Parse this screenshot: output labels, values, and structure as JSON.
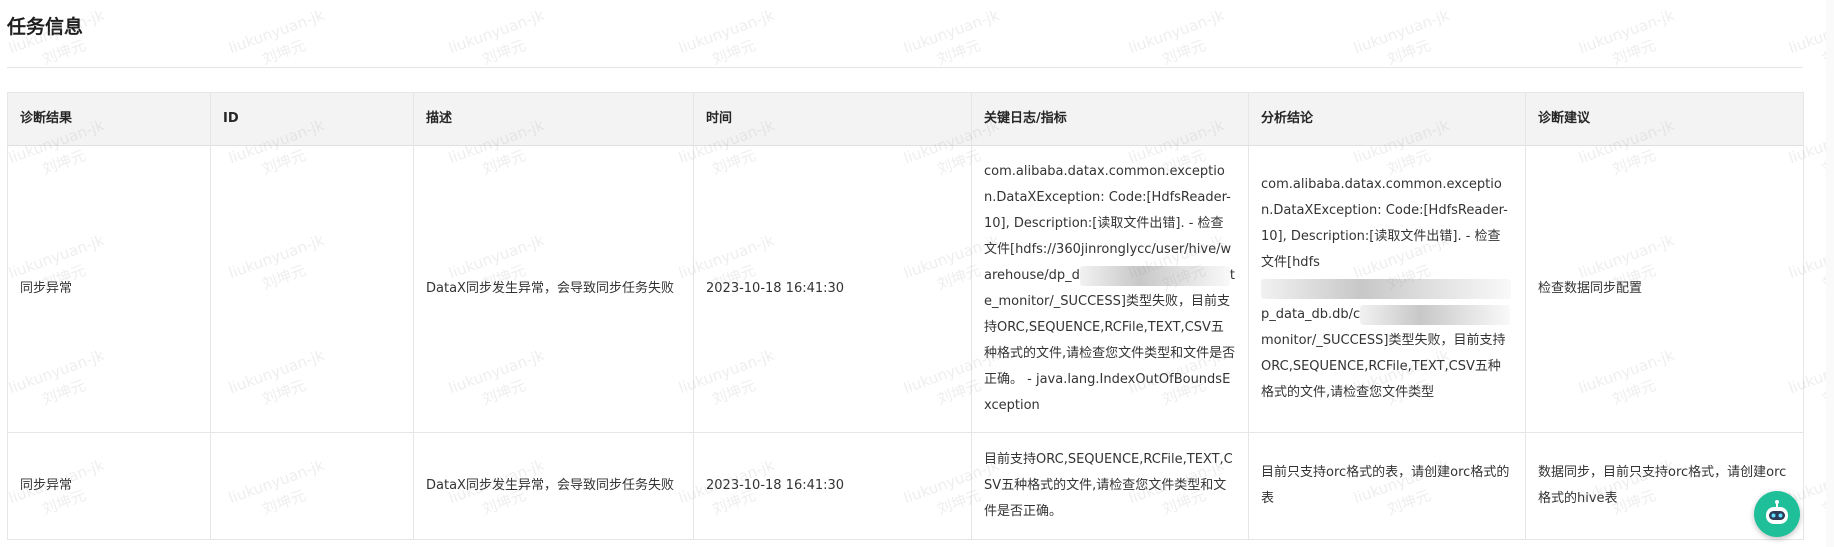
{
  "section": {
    "title": "任务信息"
  },
  "table": {
    "headers": [
      "诊断结果",
      "ID",
      "描述",
      "时间",
      "关键日志/指标",
      "分析结论",
      "诊断建议"
    ],
    "rows": [
      {
        "result": "同步异常",
        "id": "",
        "description": "DataX同步发生异常，会导致同步任务失败",
        "time": "2023-10-18 16:41:30",
        "log_before": "com.alibaba.datax.common.exception.DataXException: Code:[HdfsReader-10], Description:[读取文件出错]. - 检查文件[hdfs://360jinronglycc/user/hive/warehouse/dp_d",
        "log_after": "te_monitor/_SUCCESS]类型失败，目前支持ORC,SEQUENCE,RCFile,TEXT,CSV五种格式的文件,请检查您文件类型和文件是否正确。 - java.lang.IndexOutOfBoundsException",
        "analysis_before": "com.alibaba.datax.common.exception.DataXException: Code:[HdfsReader-10], Description:[读取文件出错]. - 检查文件[hdfs",
        "analysis_mid": "p_data_db.db/c",
        "analysis_after": "monitor/_SUCCESS]类型失败，目前支持ORC,SEQUENCE,RCFile,TEXT,CSV五种格式的文件,请检查您文件类型",
        "suggestion": "检查数据同步配置"
      },
      {
        "result": "同步异常",
        "id": "",
        "description": "DataX同步发生异常，会导致同步任务失败",
        "time": "2023-10-18 16:41:30",
        "log": "目前支持ORC,SEQUENCE,RCFile,TEXT,CSV五种格式的文件,请检查您文件类型和文件是否正确。",
        "analysis": "目前只支持orc格式的表，请创建orc格式的表",
        "suggestion": "数据同步，目前只支持orc格式，请创建orc格式的hive表"
      }
    ]
  },
  "watermark": {
    "user": "liukunyuan-jk",
    "name": "刘坤元"
  },
  "assistant": {
    "icon": "robot-icon"
  },
  "colors": {
    "header_bg": "#f3f3f3",
    "border": "#e6e6e6",
    "assistant_bg": "#1fbf9a"
  }
}
